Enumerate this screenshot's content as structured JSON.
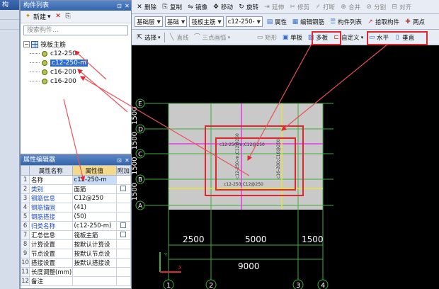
{
  "left_strip": {
    "title": "构"
  },
  "component_panel": {
    "title": "构件列表",
    "toolbar": {
      "new_label": "新建",
      "new_arrow": "▾",
      "delete_icon": "✕",
      "copy_icon": "⎘"
    },
    "search_placeholder": "搜索构件...",
    "tree": {
      "root": "筏板主筋",
      "children": [
        "c12-250",
        "c12-250-m",
        "c16-200",
        "c16-200"
      ]
    }
  },
  "property_panel": {
    "title": "属性编辑器",
    "headers": [
      "属性名称",
      "属性值",
      "附加"
    ],
    "rows": [
      {
        "num": "1",
        "name": "名称",
        "value": "c12-250-m",
        "check": false
      },
      {
        "num": "2",
        "name": "类别",
        "value": "面筋",
        "check": true
      },
      {
        "num": "3",
        "name": "钢筋信息",
        "value": "C12@250",
        "check": false
      },
      {
        "num": "4",
        "name": "钢筋锚固",
        "value": "(41)",
        "check": false
      },
      {
        "num": "5",
        "name": "钢筋搭接",
        "value": "(50)",
        "check": false
      },
      {
        "num": "6",
        "name": "归类名称",
        "value": "(c12-250-m)",
        "check": true
      },
      {
        "num": "7",
        "name": "汇总信息",
        "value": "筏板主筋",
        "check": true
      },
      {
        "num": "8",
        "name": "计算设置",
        "value": "按默认计算设",
        "check": false
      },
      {
        "num": "9",
        "name": "节点设置",
        "value": "按默认节点设",
        "check": false
      },
      {
        "num": "10",
        "name": "搭接设置",
        "value": "按默认搭接设",
        "check": false
      },
      {
        "num": "11",
        "name": "长度调整(mm)",
        "value": "",
        "check": false
      },
      {
        "num": "12",
        "name": "备注",
        "value": "",
        "check": false
      }
    ]
  },
  "toolbar1": [
    "删除",
    "复制",
    "镜像",
    "移动",
    "旋转",
    "延伸",
    "修剪",
    "打断",
    "合并",
    "分割",
    "对齐"
  ],
  "toolbar2": {
    "floor_select": "基础层",
    "category_select": "基础",
    "type_select": "筏板主筋",
    "component_select": "c12-250-",
    "buttons": [
      "属性",
      "编辑钢筋",
      "构件列表",
      "拾取构件",
      "两点"
    ]
  },
  "toolbar3": {
    "select_label": "选择",
    "draw_items": [
      "直线",
      "三点画弧"
    ],
    "rect_label": "矩形",
    "single_board": "单板",
    "multi_board": "多板",
    "custom": "自定义",
    "horizontal": "水平",
    "vertical": "垂直"
  },
  "cad": {
    "row_axes": [
      "E",
      "D",
      "C",
      "B",
      "A"
    ],
    "row_dims": [
      "1500",
      "1500",
      "1500",
      "1500"
    ],
    "col_axes": [
      "1",
      "2",
      "3",
      "4"
    ],
    "col_dims": [
      "2500",
      "5000",
      "1500"
    ],
    "total_dim": "9000",
    "labels": {
      "top_rebar": "c12-250-m;C12@250",
      "bottom_rebar": "c12-250;C12@250",
      "left_vertical": "c12-250-m;C12@250",
      "right_vertical": "c16-200;C16@200"
    },
    "axis_y": "Y",
    "axis_x": "X"
  },
  "colors": {
    "accent": "#2f6ccf",
    "annotation_red": "#e0262f",
    "magenta": "#e23ee6",
    "yellow": "#e6e43a",
    "grid_green": "#3fae3f"
  }
}
